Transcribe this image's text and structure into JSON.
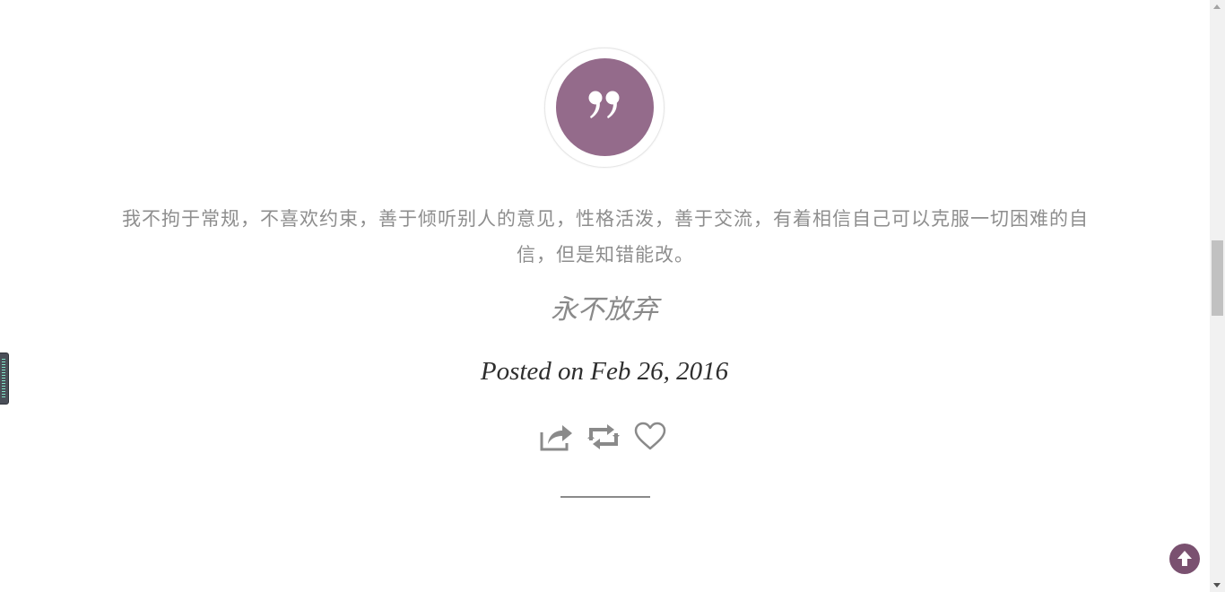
{
  "post": {
    "quote_text": "我不拘于常规，不喜欢约束，善于倾听别人的意见，性格活泼，善于交流，有着相信自己可以克服一切困难的自信，但是知错能改。",
    "quote_author": "永不放弃",
    "posted_label": "Posted on Feb 26, 2016"
  },
  "icons": {
    "quote": "quote-icon",
    "share": "share-icon",
    "repost": "repost-icon",
    "like": "heart-icon",
    "back_to_top": "arrow-up-icon"
  },
  "colors": {
    "accent": "#946b8b",
    "back_to_top": "#7a5170",
    "quote_text": "#8e8e8e",
    "posted_text": "#2e2e2e",
    "icon": "#8a8a8a"
  }
}
